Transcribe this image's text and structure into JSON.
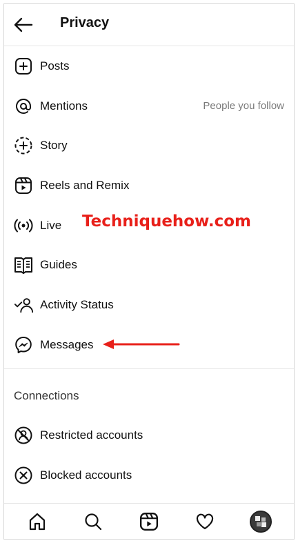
{
  "header": {
    "title": "Privacy",
    "back_icon": "arrow-left-icon"
  },
  "interactions": [
    {
      "key": "posts",
      "label": "Posts",
      "icon": "plus-square-icon"
    },
    {
      "key": "mentions",
      "label": "Mentions",
      "value": "People you follow",
      "icon": "at-sign-icon"
    },
    {
      "key": "story",
      "label": "Story",
      "icon": "story-plus-icon"
    },
    {
      "key": "reels",
      "label": "Reels and Remix",
      "icon": "reels-icon"
    },
    {
      "key": "live",
      "label": "Live",
      "icon": "live-broadcast-icon"
    },
    {
      "key": "guides",
      "label": "Guides",
      "icon": "guide-book-icon"
    },
    {
      "key": "activity",
      "label": "Activity Status",
      "icon": "activity-status-icon"
    },
    {
      "key": "messages",
      "label": "Messages",
      "icon": "messenger-icon"
    }
  ],
  "connections": {
    "title": "Connections",
    "items": [
      {
        "key": "restricted",
        "label": "Restricted accounts",
        "icon": "restricted-icon"
      },
      {
        "key": "blocked",
        "label": "Blocked accounts",
        "icon": "blocked-x-icon"
      }
    ]
  },
  "watermark": "Techniquehow.com",
  "tabbar": [
    "home-icon",
    "search-icon",
    "reels-tab-icon",
    "heart-icon",
    "profile-avatar"
  ],
  "colors": {
    "accent_red": "#e8201a",
    "text": "#111111",
    "muted": "#7a7a7a",
    "divider": "#e6e6e6"
  }
}
